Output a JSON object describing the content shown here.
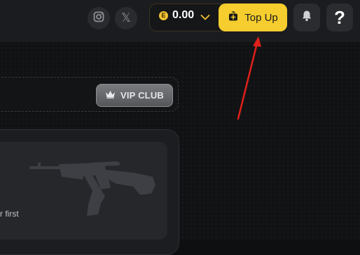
{
  "header": {
    "social": [
      {
        "icon": "instagram-icon"
      },
      {
        "icon": "x-icon",
        "glyph": "𝕏"
      }
    ],
    "wallet": {
      "coin_symbol": "E",
      "balance": "0.00",
      "dropdown_icon": "chevron-down-icon"
    },
    "topup": {
      "label": "Top Up",
      "icon": "wallet-plus-icon"
    },
    "notifications": {
      "icon": "bell-icon"
    },
    "help": {
      "glyph": "?"
    }
  },
  "vip": {
    "label": "VIP CLUB",
    "icon": "crown-icon"
  },
  "card": {
    "text": "r first",
    "image": "rifle-silhouette"
  },
  "colors": {
    "accent": "#f6cd2e",
    "annotation_arrow": "#e0201b",
    "background": "#0e0f11"
  }
}
